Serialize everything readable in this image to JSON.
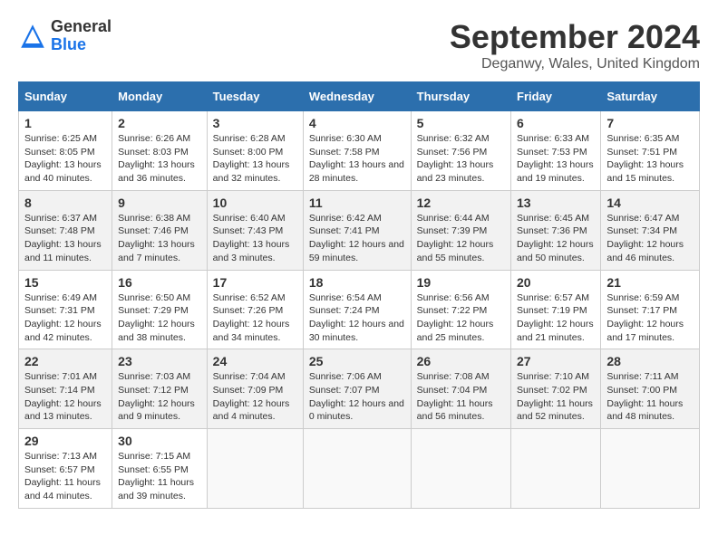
{
  "header": {
    "logo_general": "General",
    "logo_blue": "Blue",
    "month_title": "September 2024",
    "location": "Deganwy, Wales, United Kingdom"
  },
  "calendar": {
    "days_of_week": [
      "Sunday",
      "Monday",
      "Tuesday",
      "Wednesday",
      "Thursday",
      "Friday",
      "Saturday"
    ],
    "weeks": [
      [
        null,
        {
          "day": "2",
          "sunrise": "Sunrise: 6:26 AM",
          "sunset": "Sunset: 8:03 PM",
          "daylight": "Daylight: 13 hours and 36 minutes."
        },
        {
          "day": "3",
          "sunrise": "Sunrise: 6:28 AM",
          "sunset": "Sunset: 8:00 PM",
          "daylight": "Daylight: 13 hours and 32 minutes."
        },
        {
          "day": "4",
          "sunrise": "Sunrise: 6:30 AM",
          "sunset": "Sunset: 7:58 PM",
          "daylight": "Daylight: 13 hours and 28 minutes."
        },
        {
          "day": "5",
          "sunrise": "Sunrise: 6:32 AM",
          "sunset": "Sunset: 7:56 PM",
          "daylight": "Daylight: 13 hours and 23 minutes."
        },
        {
          "day": "6",
          "sunrise": "Sunrise: 6:33 AM",
          "sunset": "Sunset: 7:53 PM",
          "daylight": "Daylight: 13 hours and 19 minutes."
        },
        {
          "day": "7",
          "sunrise": "Sunrise: 6:35 AM",
          "sunset": "Sunset: 7:51 PM",
          "daylight": "Daylight: 13 hours and 15 minutes."
        }
      ],
      [
        {
          "day": "1",
          "sunrise": "Sunrise: 6:25 AM",
          "sunset": "Sunset: 8:05 PM",
          "daylight": "Daylight: 13 hours and 40 minutes."
        },
        {
          "day": "9",
          "sunrise": "Sunrise: 6:38 AM",
          "sunset": "Sunset: 7:46 PM",
          "daylight": "Daylight: 13 hours and 7 minutes."
        },
        {
          "day": "10",
          "sunrise": "Sunrise: 6:40 AM",
          "sunset": "Sunset: 7:43 PM",
          "daylight": "Daylight: 13 hours and 3 minutes."
        },
        {
          "day": "11",
          "sunrise": "Sunrise: 6:42 AM",
          "sunset": "Sunset: 7:41 PM",
          "daylight": "Daylight: 12 hours and 59 minutes."
        },
        {
          "day": "12",
          "sunrise": "Sunrise: 6:44 AM",
          "sunset": "Sunset: 7:39 PM",
          "daylight": "Daylight: 12 hours and 55 minutes."
        },
        {
          "day": "13",
          "sunrise": "Sunrise: 6:45 AM",
          "sunset": "Sunset: 7:36 PM",
          "daylight": "Daylight: 12 hours and 50 minutes."
        },
        {
          "day": "14",
          "sunrise": "Sunrise: 6:47 AM",
          "sunset": "Sunset: 7:34 PM",
          "daylight": "Daylight: 12 hours and 46 minutes."
        }
      ],
      [
        {
          "day": "8",
          "sunrise": "Sunrise: 6:37 AM",
          "sunset": "Sunset: 7:48 PM",
          "daylight": "Daylight: 13 hours and 11 minutes."
        },
        {
          "day": "16",
          "sunrise": "Sunrise: 6:50 AM",
          "sunset": "Sunset: 7:29 PM",
          "daylight": "Daylight: 12 hours and 38 minutes."
        },
        {
          "day": "17",
          "sunrise": "Sunrise: 6:52 AM",
          "sunset": "Sunset: 7:26 PM",
          "daylight": "Daylight: 12 hours and 34 minutes."
        },
        {
          "day": "18",
          "sunrise": "Sunrise: 6:54 AM",
          "sunset": "Sunset: 7:24 PM",
          "daylight": "Daylight: 12 hours and 30 minutes."
        },
        {
          "day": "19",
          "sunrise": "Sunrise: 6:56 AM",
          "sunset": "Sunset: 7:22 PM",
          "daylight": "Daylight: 12 hours and 25 minutes."
        },
        {
          "day": "20",
          "sunrise": "Sunrise: 6:57 AM",
          "sunset": "Sunset: 7:19 PM",
          "daylight": "Daylight: 12 hours and 21 minutes."
        },
        {
          "day": "21",
          "sunrise": "Sunrise: 6:59 AM",
          "sunset": "Sunset: 7:17 PM",
          "daylight": "Daylight: 12 hours and 17 minutes."
        }
      ],
      [
        {
          "day": "15",
          "sunrise": "Sunrise: 6:49 AM",
          "sunset": "Sunset: 7:31 PM",
          "daylight": "Daylight: 12 hours and 42 minutes."
        },
        {
          "day": "23",
          "sunrise": "Sunrise: 7:03 AM",
          "sunset": "Sunset: 7:12 PM",
          "daylight": "Daylight: 12 hours and 9 minutes."
        },
        {
          "day": "24",
          "sunrise": "Sunrise: 7:04 AM",
          "sunset": "Sunset: 7:09 PM",
          "daylight": "Daylight: 12 hours and 4 minutes."
        },
        {
          "day": "25",
          "sunrise": "Sunrise: 7:06 AM",
          "sunset": "Sunset: 7:07 PM",
          "daylight": "Daylight: 12 hours and 0 minutes."
        },
        {
          "day": "26",
          "sunrise": "Sunrise: 7:08 AM",
          "sunset": "Sunset: 7:04 PM",
          "daylight": "Daylight: 11 hours and 56 minutes."
        },
        {
          "day": "27",
          "sunrise": "Sunrise: 7:10 AM",
          "sunset": "Sunset: 7:02 PM",
          "daylight": "Daylight: 11 hours and 52 minutes."
        },
        {
          "day": "28",
          "sunrise": "Sunrise: 7:11 AM",
          "sunset": "Sunset: 7:00 PM",
          "daylight": "Daylight: 11 hours and 48 minutes."
        }
      ],
      [
        {
          "day": "22",
          "sunrise": "Sunrise: 7:01 AM",
          "sunset": "Sunset: 7:14 PM",
          "daylight": "Daylight: 12 hours and 13 minutes."
        },
        {
          "day": "30",
          "sunrise": "Sunrise: 7:15 AM",
          "sunset": "Sunset: 6:55 PM",
          "daylight": "Daylight: 11 hours and 39 minutes."
        },
        null,
        null,
        null,
        null,
        null
      ],
      [
        {
          "day": "29",
          "sunrise": "Sunrise: 7:13 AM",
          "sunset": "Sunset: 6:57 PM",
          "daylight": "Daylight: 11 hours and 44 minutes."
        },
        null,
        null,
        null,
        null,
        null,
        null
      ]
    ]
  }
}
